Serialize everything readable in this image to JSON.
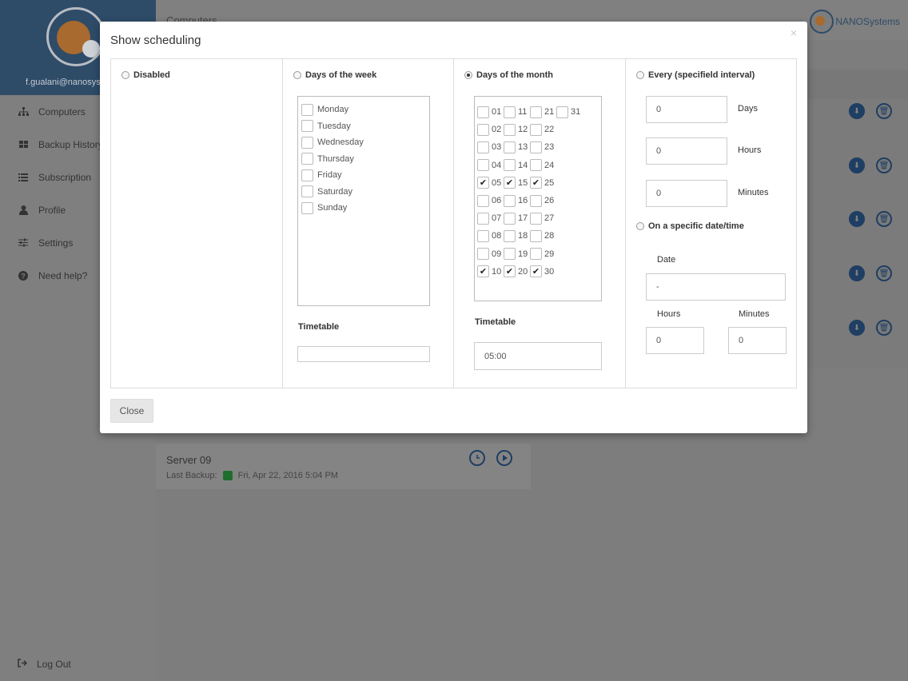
{
  "sidebar": {
    "user_email": "f.gualani@nanosystems.it",
    "items": [
      {
        "label": "Computers",
        "icon": "sitemap-icon"
      },
      {
        "label": "Backup History",
        "icon": "grid-icon"
      },
      {
        "label": "Subscription",
        "icon": "list-icon"
      },
      {
        "label": "Profile",
        "icon": "user-icon"
      },
      {
        "label": "Settings",
        "icon": "sliders-icon"
      },
      {
        "label": "Need help?",
        "icon": "question-icon"
      }
    ],
    "logout_label": "Log Out"
  },
  "header": {
    "breadcrumb": "Computers",
    "brand_name": "NANOSystems"
  },
  "server_card": {
    "name": "Server 09",
    "last_backup_label": "Last Backup:",
    "last_backup_value": "Fri, Apr 22, 2016 5:04 PM",
    "status_color": "#1f6e2d"
  },
  "modal": {
    "title": "Show scheduling",
    "close_symbol": "×",
    "close_button": "Close",
    "disabled": {
      "label": "Disabled",
      "selected": false
    },
    "days_of_week": {
      "label": "Days of the week",
      "selected": false,
      "days": [
        "Monday",
        "Tuesday",
        "Wednesday",
        "Thursday",
        "Friday",
        "Saturday",
        "Sunday"
      ],
      "timetable_label": "Timetable",
      "timetable_value": ""
    },
    "days_of_month": {
      "label": "Days of the month",
      "selected": true,
      "days": [
        {
          "n": "01",
          "checked": false
        },
        {
          "n": "02",
          "checked": false
        },
        {
          "n": "03",
          "checked": false
        },
        {
          "n": "04",
          "checked": false
        },
        {
          "n": "05",
          "checked": true
        },
        {
          "n": "06",
          "checked": false
        },
        {
          "n": "07",
          "checked": false
        },
        {
          "n": "08",
          "checked": false
        },
        {
          "n": "09",
          "checked": false
        },
        {
          "n": "10",
          "checked": true
        },
        {
          "n": "11",
          "checked": false
        },
        {
          "n": "12",
          "checked": false
        },
        {
          "n": "13",
          "checked": false
        },
        {
          "n": "14",
          "checked": false
        },
        {
          "n": "15",
          "checked": true
        },
        {
          "n": "16",
          "checked": false
        },
        {
          "n": "17",
          "checked": false
        },
        {
          "n": "18",
          "checked": false
        },
        {
          "n": "19",
          "checked": false
        },
        {
          "n": "20",
          "checked": true
        },
        {
          "n": "21",
          "checked": false
        },
        {
          "n": "22",
          "checked": false
        },
        {
          "n": "23",
          "checked": false
        },
        {
          "n": "24",
          "checked": false
        },
        {
          "n": "25",
          "checked": true
        },
        {
          "n": "26",
          "checked": false
        },
        {
          "n": "27",
          "checked": false
        },
        {
          "n": "28",
          "checked": false
        },
        {
          "n": "29",
          "checked": false
        },
        {
          "n": "30",
          "checked": true
        },
        {
          "n": "31",
          "checked": false
        }
      ],
      "timetable_label": "Timetable",
      "timetable_value": "05:00"
    },
    "every_interval": {
      "label": "Every (specifield interval)",
      "selected": false,
      "days_value": "0",
      "days_label": "Days",
      "hours_value": "0",
      "hours_label": "Hours",
      "minutes_value": "0",
      "minutes_label": "Minutes"
    },
    "specific_datetime": {
      "label": "On a specific date/time",
      "selected": false,
      "date_label": "Date",
      "date_value": "-",
      "hours_label": "Hours",
      "hours_value": "0",
      "minutes_label": "Minutes",
      "minutes_value": "0"
    }
  }
}
